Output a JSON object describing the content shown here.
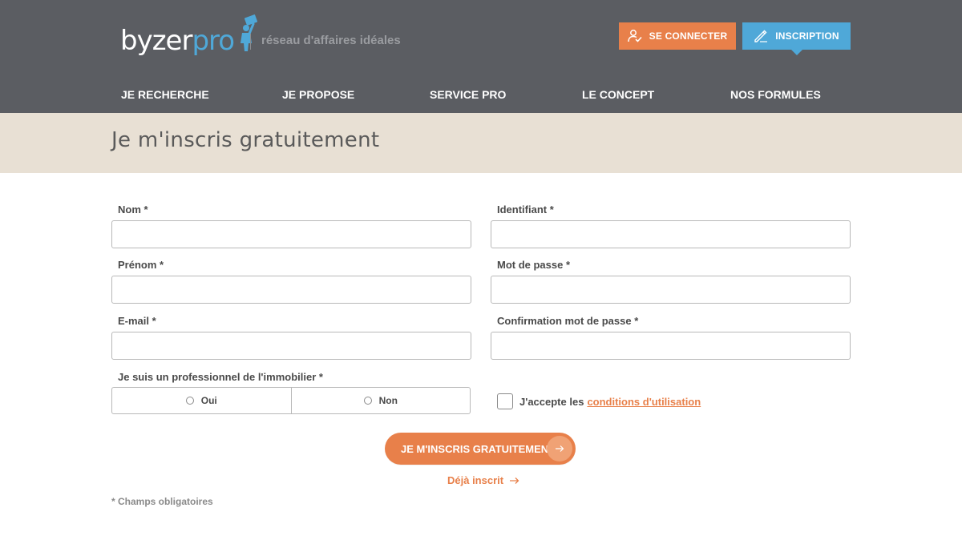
{
  "brand": {
    "logo_main": "byzer",
    "logo_accent": "pro",
    "tagline": "réseau d'affaires idéales"
  },
  "header": {
    "connect_label": "SE CONNECTER",
    "register_label": "INSCRIPTION"
  },
  "nav": {
    "items": [
      {
        "label": "JE RECHERCHE"
      },
      {
        "label": "JE PROPOSE"
      },
      {
        "label": "SERVICE PRO"
      },
      {
        "label": "LE CONCEPT"
      },
      {
        "label": "NOS FORMULES"
      }
    ]
  },
  "page": {
    "title": "Je m'inscris gratuitement"
  },
  "form": {
    "nom": {
      "label": "Nom *",
      "value": "",
      "placeholder": ""
    },
    "prenom": {
      "label": "Prénom *",
      "value": "",
      "placeholder": ""
    },
    "email": {
      "label": "E-mail *",
      "value": "",
      "placeholder": ""
    },
    "identifiant": {
      "label": "Identifiant *",
      "value": "",
      "placeholder": ""
    },
    "password": {
      "label": "Mot de passe *",
      "value": "",
      "placeholder": ""
    },
    "password_confirm": {
      "label": "Confirmation mot de passe *",
      "value": "",
      "placeholder": ""
    },
    "pro": {
      "label": "Je suis un professionnel de l'immobilier *",
      "options": [
        "Oui",
        "Non"
      ],
      "selected": null
    },
    "cgu": {
      "text": "J'accepte les",
      "link": "conditions d'utilisation",
      "checked": false
    },
    "submit_label": "JE M'INSCRIS GRATUITEMENT",
    "already_label": "Déjà inscrit",
    "mandatory_note": "* Champs obligatoires"
  },
  "colors": {
    "header_bg": "#5b5d62",
    "band_bg": "#e8e0d4",
    "accent_orange": "#e8804a",
    "accent_blue": "#4fa8d8"
  }
}
